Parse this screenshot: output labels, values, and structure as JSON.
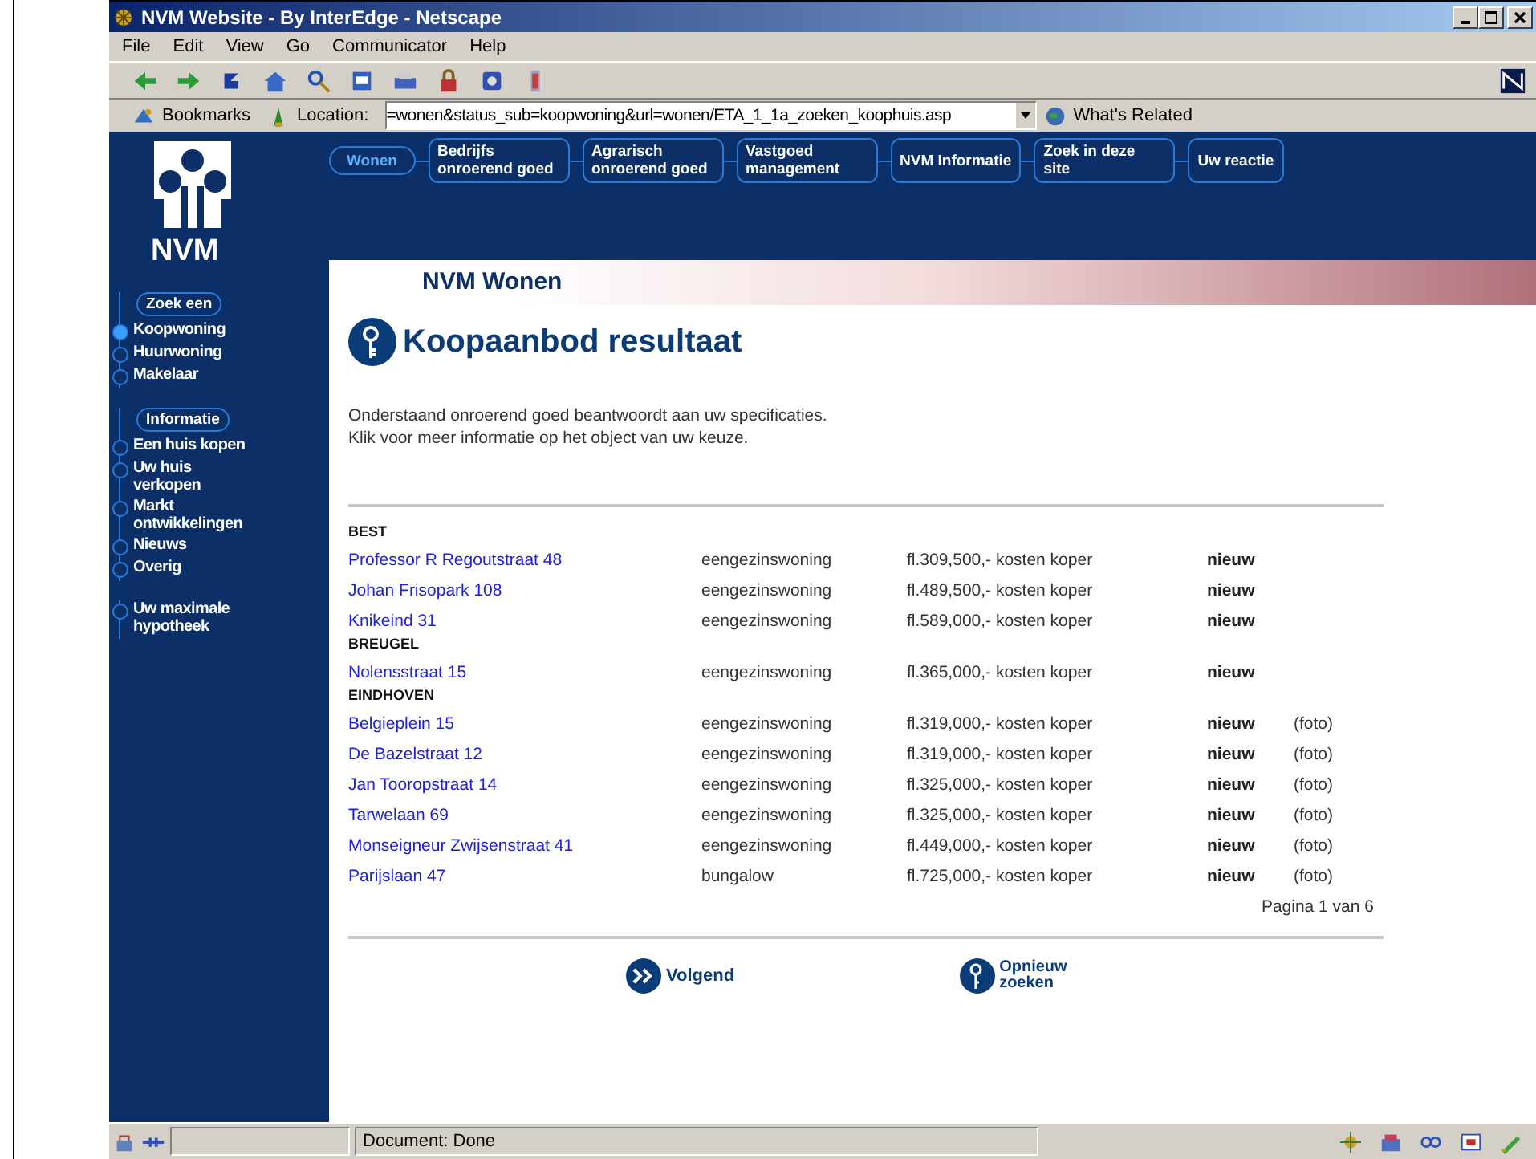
{
  "window": {
    "title": "NVM Website - By InterEdge - Netscape"
  },
  "menu": [
    "File",
    "Edit",
    "View",
    "Go",
    "Communicator",
    "Help"
  ],
  "location_bar": {
    "bookmarks": "Bookmarks",
    "label": "Location:",
    "value": "=wonen&status_sub=koopwoning&url=wonen/ETA_1_1a_zoeken_koophuis.asp",
    "related": "What's Related"
  },
  "site_nav": [
    {
      "label": "Wonen",
      "selected": true
    },
    {
      "label": "Bedrijfs onroerend goed",
      "selected": false
    },
    {
      "label": "Agrarisch onroerend goed",
      "selected": false
    },
    {
      "label": "Vastgoed management",
      "selected": false
    },
    {
      "label": "NVM Informatie",
      "selected": false
    },
    {
      "label": "Zoek in deze site",
      "selected": false
    },
    {
      "label": "Uw reactie",
      "selected": false
    }
  ],
  "sidebar": {
    "logo_text": "NVM",
    "sections": [
      {
        "heading": "Zoek een",
        "items": [
          {
            "label": "Koopwoning",
            "selected": true
          },
          {
            "label": "Huurwoning",
            "selected": false
          },
          {
            "label": "Makelaar",
            "selected": false
          }
        ]
      },
      {
        "heading": "Informatie",
        "items": [
          {
            "label": "Een huis kopen",
            "selected": false
          },
          {
            "label": "Uw huis verkopen",
            "selected": false
          },
          {
            "label": "Markt ontwikkelingen",
            "selected": false
          },
          {
            "label": "Nieuws",
            "selected": false
          },
          {
            "label": "Overig",
            "selected": false
          }
        ]
      },
      {
        "items": [
          {
            "label": "Uw maximale hypotheek",
            "selected": false
          }
        ]
      }
    ]
  },
  "section_header": "NVM Wonen",
  "page_title": "Koopaanbod resultaat",
  "intro": [
    "Onderstaand onroerend goed beantwoordt aan uw specificaties.",
    "Klik voor meer informatie op het object van uw keuze."
  ],
  "listings": [
    {
      "city": "BEST",
      "rows": [
        {
          "address": "Professor R Regoutstraat 48",
          "type": "eengezinswoning",
          "price": "fl.309,500,- kosten koper",
          "status": "nieuw"
        },
        {
          "address": "Johan Frisopark 108",
          "type": "eengezinswoning",
          "price": "fl.489,500,- kosten koper",
          "status": "nieuw"
        },
        {
          "address": "Knikeind 31",
          "type": "eengezinswoning",
          "price": "fl.589,000,- kosten koper",
          "status": "nieuw"
        }
      ]
    },
    {
      "city": "BREUGEL",
      "rows": [
        {
          "address": "Nolensstraat 15",
          "type": "eengezinswoning",
          "price": "fl.365,000,- kosten koper",
          "status": "nieuw"
        }
      ]
    },
    {
      "city": "EINDHOVEN",
      "rows": [
        {
          "address": "Belgieplein 15",
          "type": "eengezinswoning",
          "price": "fl.319,000,- kosten koper",
          "status": "nieuw",
          "photo": "(foto)"
        },
        {
          "address": "De Bazelstraat 12",
          "type": "eengezinswoning",
          "price": "fl.319,000,- kosten koper",
          "status": "nieuw",
          "photo": "(foto)"
        },
        {
          "address": "Jan Tooropstraat 14",
          "type": "eengezinswoning",
          "price": "fl.325,000,- kosten koper",
          "status": "nieuw",
          "photo": "(foto)"
        },
        {
          "address": "Tarwelaan 69",
          "type": "eengezinswoning",
          "price": "fl.325,000,- kosten koper",
          "status": "nieuw",
          "photo": "(foto)"
        },
        {
          "address": "Monseigneur Zwijsenstraat 41",
          "type": "eengezinswoning",
          "price": "fl.449,000,- kosten koper",
          "status": "nieuw",
          "photo": "(foto)"
        },
        {
          "address": "Parijslaan 47",
          "type": "bungalow",
          "price": "fl.725,000,- kosten koper",
          "status": "nieuw",
          "photo": "(foto)"
        }
      ]
    }
  ],
  "pagination": "Pagina 1 van 6",
  "actions": [
    {
      "kind": "next",
      "label": "Volgend"
    },
    {
      "kind": "search",
      "label": "Opnieuw zoeken"
    }
  ],
  "status_bar": "Document: Done"
}
